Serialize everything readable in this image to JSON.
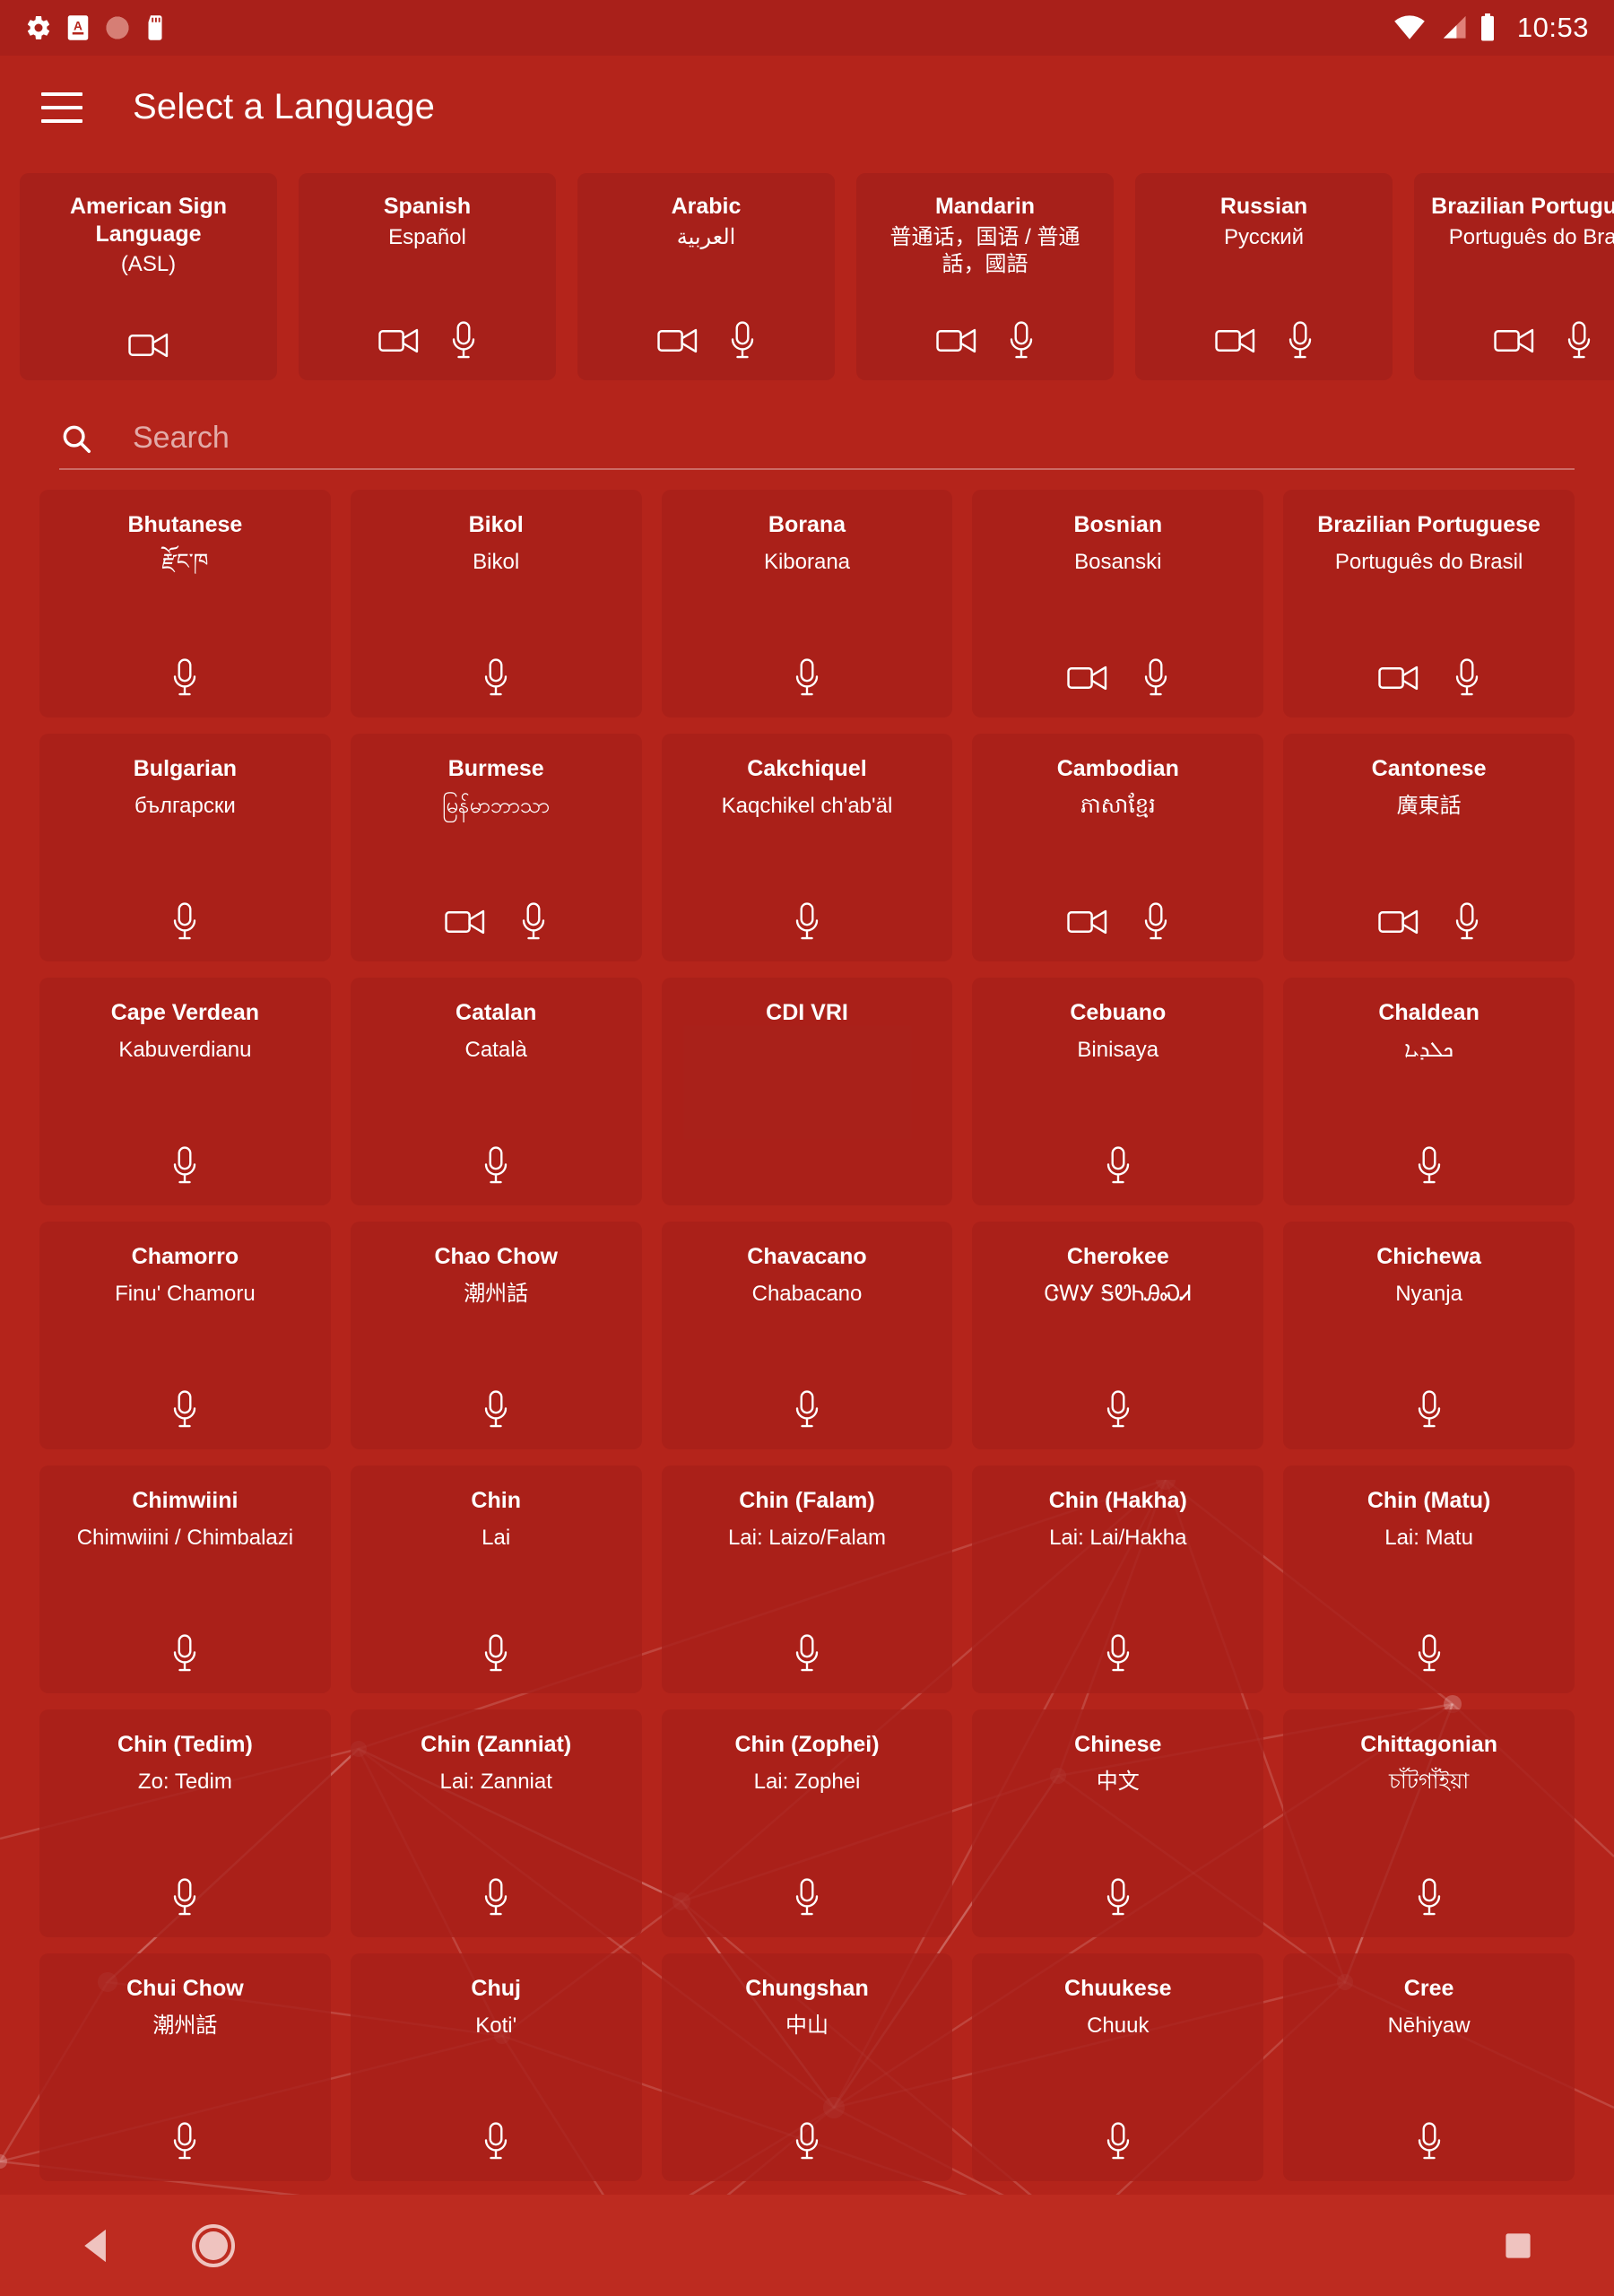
{
  "statusbar": {
    "time": "10:53",
    "left_icons": [
      "gear-icon",
      "app-badge-icon",
      "record-icon",
      "sdcard-icon"
    ],
    "right_icons": [
      "wifi-icon",
      "signal-icon",
      "battery-icon"
    ]
  },
  "appbar": {
    "menu_icon": "hamburger-menu-icon",
    "title": "Select a Language"
  },
  "favorites": [
    {
      "name": "American Sign Language",
      "native": "(ASL)",
      "video": true,
      "audio": false
    },
    {
      "name": "Spanish",
      "native": "Español",
      "video": true,
      "audio": true
    },
    {
      "name": "Arabic",
      "native": "العربية",
      "video": true,
      "audio": true
    },
    {
      "name": "Mandarin",
      "native": "普通话，国语 / 普通話，國語",
      "video": true,
      "audio": true
    },
    {
      "name": "Russian",
      "native": "Русский",
      "video": true,
      "audio": true
    },
    {
      "name": "Brazilian Portuguese",
      "native": "Português do Brasil",
      "video": true,
      "audio": true
    }
  ],
  "search": {
    "icon": "search-icon",
    "value": "",
    "placeholder": "Search"
  },
  "languages": [
    {
      "name": "Bhutanese",
      "native": "རྫོང་ཁ",
      "video": false,
      "audio": true
    },
    {
      "name": "Bikol",
      "native": "Bikol",
      "video": false,
      "audio": true
    },
    {
      "name": "Borana",
      "native": "Kiborana",
      "video": false,
      "audio": true
    },
    {
      "name": "Bosnian",
      "native": "Bosanski",
      "video": true,
      "audio": true
    },
    {
      "name": "Brazilian Portuguese",
      "native": "Português do Brasil",
      "video": true,
      "audio": true
    },
    {
      "name": "Bulgarian",
      "native": "български",
      "video": false,
      "audio": true
    },
    {
      "name": "Burmese",
      "native": "မြန်မာဘာသာ",
      "video": true,
      "audio": true
    },
    {
      "name": "Cakchiquel",
      "native": "Kaqchikel ch'ab'äl",
      "video": false,
      "audio": true
    },
    {
      "name": "Cambodian",
      "native": "ភាសាខ្មែរ",
      "video": true,
      "audio": true
    },
    {
      "name": "Cantonese",
      "native": "廣東話",
      "video": true,
      "audio": true
    },
    {
      "name": "Cape Verdean",
      "native": "Kabuverdianu",
      "video": false,
      "audio": true
    },
    {
      "name": "Catalan",
      "native": "Català",
      "video": false,
      "audio": true
    },
    {
      "name": "CDI VRI",
      "native": "",
      "video": false,
      "audio": false
    },
    {
      "name": "Cebuano",
      "native": "Binisaya",
      "video": false,
      "audio": true
    },
    {
      "name": "Chaldean",
      "native": "ܟܠܕܝܐ",
      "video": false,
      "audio": true
    },
    {
      "name": "Chamorro",
      "native": "Finu' Chamoru",
      "video": false,
      "audio": true
    },
    {
      "name": "Chao Chow",
      "native": "潮州話",
      "video": false,
      "audio": true
    },
    {
      "name": "Chavacano",
      "native": "Chabacano",
      "video": false,
      "audio": true
    },
    {
      "name": "Cherokee",
      "native": "ᏣᎳᎩ ᎦᏬᏂᎯᏍᏗ",
      "video": false,
      "audio": true
    },
    {
      "name": "Chichewa",
      "native": "Nyanja",
      "video": false,
      "audio": true
    },
    {
      "name": "Chimwiini",
      "native": "Chimwiini / Chimbalazi",
      "video": false,
      "audio": true
    },
    {
      "name": "Chin",
      "native": "Lai",
      "video": false,
      "audio": true
    },
    {
      "name": "Chin (Falam)",
      "native": "Lai: Laizo/Falam",
      "video": false,
      "audio": true
    },
    {
      "name": "Chin (Hakha)",
      "native": "Lai: Lai/Hakha",
      "video": false,
      "audio": true
    },
    {
      "name": "Chin (Matu)",
      "native": "Lai: Matu",
      "video": false,
      "audio": true
    },
    {
      "name": "Chin (Tedim)",
      "native": "Zo: Tedim",
      "video": false,
      "audio": true
    },
    {
      "name": "Chin (Zanniat)",
      "native": "Lai: Zanniat",
      "video": false,
      "audio": true
    },
    {
      "name": "Chin (Zophei)",
      "native": "Lai: Zophei",
      "video": false,
      "audio": true
    },
    {
      "name": "Chinese",
      "native": "中文",
      "video": false,
      "audio": true
    },
    {
      "name": "Chittagonian",
      "native": "চাঁটগাঁইয়া",
      "video": false,
      "audio": true
    },
    {
      "name": "Chui Chow",
      "native": "潮州話",
      "video": false,
      "audio": true
    },
    {
      "name": "Chuj",
      "native": "Koti'",
      "video": false,
      "audio": true
    },
    {
      "name": "Chungshan",
      "native": "中山",
      "video": false,
      "audio": true
    },
    {
      "name": "Chuukese",
      "native": "Chuuk",
      "video": false,
      "audio": true
    },
    {
      "name": "Cree",
      "native": "Nēhiyaw",
      "video": false,
      "audio": true
    }
  ],
  "navbar": {
    "back_label": "back-button",
    "home_label": "home-button",
    "recents_label": "recents-button"
  },
  "colors": {
    "brand_red": "#b4241b",
    "card_red": "#a7201a",
    "statusbar_red": "#a9201a",
    "navbar_red": "#bd2b20",
    "text_white": "#ffffff"
  }
}
